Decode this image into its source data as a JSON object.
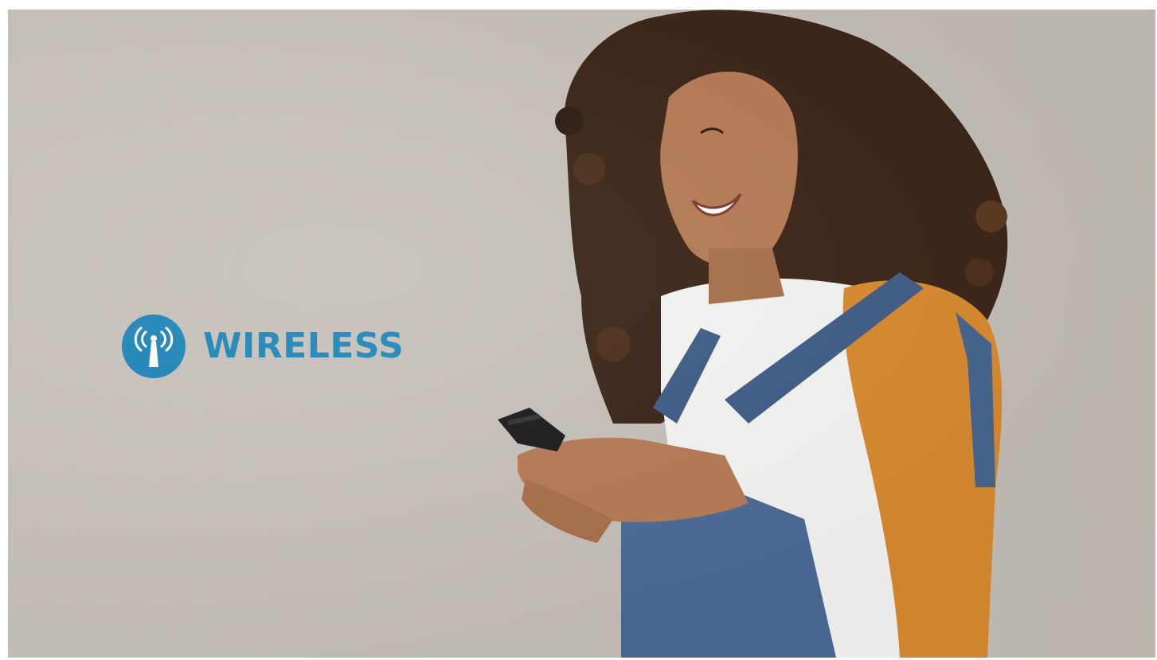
{
  "brand": {
    "name": "WIRELESS",
    "icon": "wireless-antenna-icon",
    "color": "#1e86b9"
  },
  "colors": {
    "background_wall": "#c6c0b9",
    "sleeve": "#d8892e",
    "denim": "#4a6a96",
    "shirt": "#f4f4f2",
    "hair": "#3a2416",
    "skin": "#b57a55"
  }
}
